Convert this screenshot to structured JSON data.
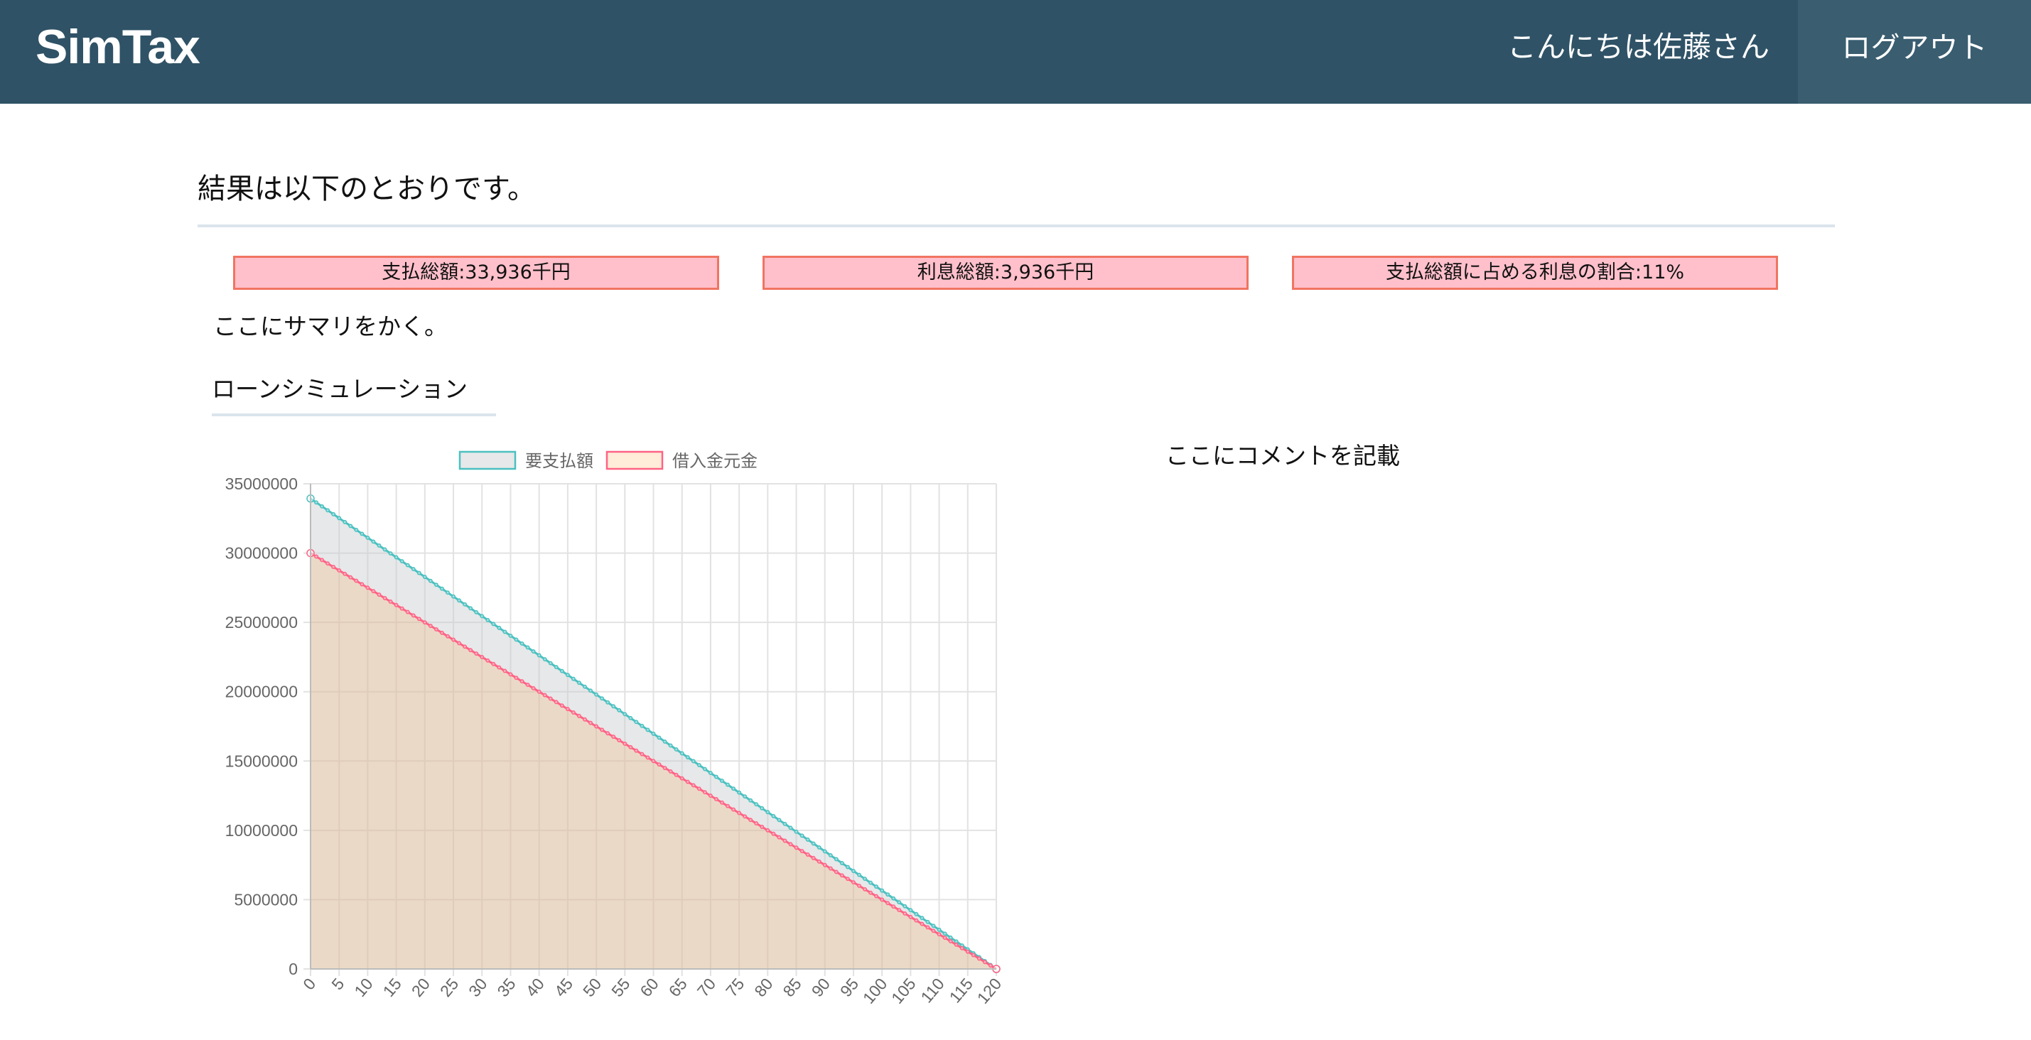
{
  "header": {
    "brand": "SimTax",
    "greeting": "こんにちは佐藤さん",
    "logout_label": "ログアウト"
  },
  "main": {
    "title": "結果は以下のとおりです。",
    "stats": [
      "支払総額:33,936千円",
      "利息総額:3,936千円",
      "支払総額に占める利息の割合:11%"
    ],
    "summary": "ここにサマリをかく。",
    "section_title": "ローンシミュレーション",
    "comment": "ここにコメントを記載"
  },
  "colors": {
    "navbar": "#2f5266",
    "stat_fill": "#ffc0cb",
    "stat_border": "#f17462",
    "series_payment_line": "#4bc0c0",
    "series_principal_line": "#ff6384"
  },
  "chart_data": {
    "type": "area",
    "x_start": 0,
    "x_end": 120,
    "x_tick_step": 5,
    "x_ticks": [
      "0",
      "5",
      "10",
      "15",
      "20",
      "25",
      "30",
      "35",
      "40",
      "45",
      "50",
      "55",
      "60",
      "65",
      "70",
      "75",
      "80",
      "85",
      "90",
      "95",
      "100",
      "105",
      "110",
      "115",
      "120"
    ],
    "ylim": [
      0,
      35000000
    ],
    "y_ticks": [
      "0",
      "5000000",
      "10000000",
      "15000000",
      "20000000",
      "25000000",
      "30000000",
      "35000000"
    ],
    "grid": true,
    "legend_position": "top",
    "series": [
      {
        "name": "要支払額",
        "start": 33936000,
        "end": 0,
        "line_color": "#4bc0c0",
        "fill_color": "rgba(201,203,207,0.45)"
      },
      {
        "name": "借入金元金",
        "start": 30000000,
        "end": 0,
        "line_color": "#ff6384",
        "fill_color": "rgba(255,159,64,0.2)"
      }
    ]
  }
}
